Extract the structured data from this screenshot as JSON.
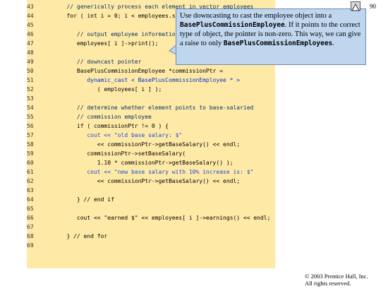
{
  "slide": {
    "number": "90"
  },
  "lines": [
    {
      "num": "43",
      "text": "   // generically process each element in vector employees",
      "cls": "c"
    },
    {
      "num": "44",
      "text": "   for ( int i = 0; i < employees.size(); i++ ) {",
      "cls": ""
    },
    {
      "num": "45",
      "text": "",
      "cls": ""
    },
    {
      "num": "46",
      "text": "      // output employee information",
      "cls": "c"
    },
    {
      "num": "47",
      "text": "      employees[ i ]->print();",
      "cls": ""
    },
    {
      "num": "48",
      "text": "",
      "cls": ""
    },
    {
      "num": "49",
      "text": "      // downcast pointer",
      "cls": "c"
    },
    {
      "num": "50",
      "text": "      BasePlusCommissionEmployee *commissionPtr =",
      "cls": ""
    },
    {
      "num": "51",
      "text": "         dynamic_cast < BasePlusCommissionEmployee * >",
      "cls": "k"
    },
    {
      "num": "52",
      "text": "            ( employees[ i ] );",
      "cls": ""
    },
    {
      "num": "53",
      "text": "",
      "cls": ""
    },
    {
      "num": "54",
      "text": "      // determine whether element points to base-salaried",
      "cls": "c"
    },
    {
      "num": "55",
      "text": "      // commission employee",
      "cls": "c"
    },
    {
      "num": "56",
      "text": "      if ( commissionPtr != 0 ) {",
      "cls": ""
    },
    {
      "num": "57",
      "text": "         cout << \"old base salary: $\"",
      "cls": "s"
    },
    {
      "num": "58",
      "text": "            << commissionPtr->getBaseSalary() << endl;",
      "cls": ""
    },
    {
      "num": "59",
      "text": "         commissionPtr->setBaseSalary(",
      "cls": ""
    },
    {
      "num": "60",
      "text": "            1.10 * commissionPtr->getBaseSalary() );",
      "cls": ""
    },
    {
      "num": "61",
      "text": "         cout << \"new base salary with 10% increase is: $\"",
      "cls": "s"
    },
    {
      "num": "62",
      "text": "            << commissionPtr->getBaseSalary() << endl;",
      "cls": ""
    },
    {
      "num": "63",
      "text": "",
      "cls": ""
    },
    {
      "num": "64",
      "text": "      } // end if",
      "cls": ""
    },
    {
      "num": "65",
      "text": "",
      "cls": ""
    },
    {
      "num": "66",
      "text": "      cout << \"earned $\" << employees[ i ]->earnings() << endl;",
      "cls": ""
    },
    {
      "num": "67",
      "text": "",
      "cls": ""
    },
    {
      "num": "68",
      "text": "   } // end for",
      "cls": ""
    },
    {
      "num": "69",
      "text": "",
      "cls": ""
    }
  ],
  "callout": {
    "part1": "Use downcasting to cast the employee object into a ",
    "mono1": "BasePlusCommissionEmployee",
    "part2": ". If it points to the correct type of object, the pointer is non-zero. This way, we can give a raise to only ",
    "mono2": "BasePlusCommissionEmployees",
    "part3": "."
  },
  "copyright": {
    "line1": "© 2003 Prentice Hall, Inc.",
    "line2": "All rights reserved."
  }
}
